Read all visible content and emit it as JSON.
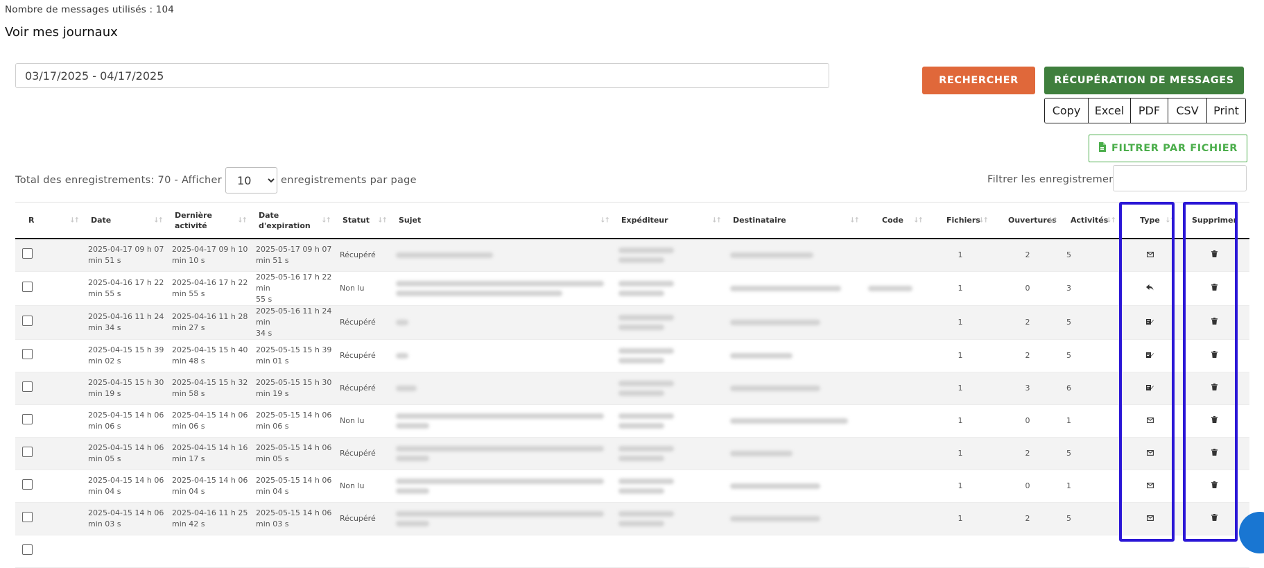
{
  "header": {
    "message_count_text": "Nombre de messages utilisés : 104",
    "title": "Voir mes journaux"
  },
  "search": {
    "date_range_value": "03/17/2025 - 04/17/2025",
    "search_label": "RECHERCHER",
    "recover_label": "RÉCUPÉRATION DE MESSAGES"
  },
  "export": {
    "copy": "Copy",
    "excel": "Excel",
    "pdf": "PDF",
    "csv": "CSV",
    "print": "Print"
  },
  "filter_file_label": "FILTRER PAR FICHIER",
  "pagination": {
    "total_prefix": "Total des enregistrements: 70 - Afficher",
    "page_size": "10",
    "page_size_suffix": "enregistrements par page",
    "filter_label": "Filtrer les enregistrements"
  },
  "columns": {
    "r": "R",
    "date": "Date",
    "last_activity_1": "Dernière",
    "last_activity_2": "activité",
    "expiry_1": "Date",
    "expiry_2": "d'expiration",
    "status": "Statut",
    "subject": "Sujet",
    "sender": "Expéditeur",
    "recipient": "Destinataire",
    "code": "Code",
    "files": "Fichiers",
    "opens": "Ouvertures",
    "activities": "Activités",
    "type": "Type",
    "delete": "Supprimer"
  },
  "rows": [
    {
      "date1": "2025-04-17 09 h 07",
      "date2": "min 51 s",
      "act1": "2025-04-17 09 h 10",
      "act2": "min 10 s",
      "exp1": "2025-05-17 09 h 07",
      "exp2": "min 51 s",
      "status": "Récupéré",
      "files": "1",
      "opens": "2",
      "activities": "5",
      "type_icon": "envelope-icon"
    },
    {
      "date1": "2025-04-16 17 h 22",
      "date2": "min 55 s",
      "act1": "2025-04-16 17 h 22",
      "act2": "min 55 s",
      "exp1": "2025-05-16 17 h 22 min",
      "exp2": "55 s",
      "status": "Non lu",
      "files": "1",
      "opens": "0",
      "activities": "3",
      "type_icon": "reply-icon"
    },
    {
      "date1": "2025-04-16 11 h 24",
      "date2": "min 34 s",
      "act1": "2025-04-16 11 h 28",
      "act2": "min 27 s",
      "exp1": "2025-05-16 11 h 24 min",
      "exp2": "34 s",
      "status": "Récupéré",
      "files": "1",
      "opens": "2",
      "activities": "5",
      "type_icon": "signature-icon"
    },
    {
      "date1": "2025-04-15 15 h 39",
      "date2": "min 02 s",
      "act1": "2025-04-15 15 h 40",
      "act2": "min 48 s",
      "exp1": "2025-05-15 15 h 39",
      "exp2": "min 01 s",
      "status": "Récupéré",
      "files": "1",
      "opens": "2",
      "activities": "5",
      "type_icon": "signature-icon"
    },
    {
      "date1": "2025-04-15 15 h 30",
      "date2": "min 19 s",
      "act1": "2025-04-15 15 h 32",
      "act2": "min 58 s",
      "exp1": "2025-05-15 15 h 30",
      "exp2": "min 19 s",
      "status": "Récupéré",
      "files": "1",
      "opens": "3",
      "activities": "6",
      "type_icon": "signature-icon"
    },
    {
      "date1": "2025-04-15 14 h 06",
      "date2": "min 06 s",
      "act1": "2025-04-15 14 h 06",
      "act2": "min 06 s",
      "exp1": "2025-05-15 14 h 06",
      "exp2": "min 06 s",
      "status": "Non lu",
      "files": "1",
      "opens": "0",
      "activities": "1",
      "type_icon": "envelope-icon"
    },
    {
      "date1": "2025-04-15 14 h 06",
      "date2": "min 05 s",
      "act1": "2025-04-15 14 h 16",
      "act2": "min 17 s",
      "exp1": "2025-05-15 14 h 06",
      "exp2": "min 05 s",
      "status": "Récupéré",
      "files": "1",
      "opens": "2",
      "activities": "5",
      "type_icon": "envelope-icon"
    },
    {
      "date1": "2025-04-15 14 h 06",
      "date2": "min 04 s",
      "act1": "2025-04-15 14 h 06",
      "act2": "min 04 s",
      "exp1": "2025-05-15 14 h 06",
      "exp2": "min 04 s",
      "status": "Non lu",
      "files": "1",
      "opens": "0",
      "activities": "1",
      "type_icon": "envelope-icon"
    },
    {
      "date1": "2025-04-15 14 h 06",
      "date2": "min 03 s",
      "act1": "2025-04-16 11 h 25",
      "act2": "min 42 s",
      "exp1": "2025-05-15 14 h 06",
      "exp2": "min 03 s",
      "status": "Récupéré",
      "files": "1",
      "opens": "2",
      "activities": "5",
      "type_icon": "envelope-icon"
    },
    {
      "date1": "",
      "date2": "",
      "act1": "",
      "act2": "",
      "exp1": "",
      "exp2": "",
      "status": "",
      "files": "",
      "opens": "",
      "activities": "",
      "type_icon": ""
    }
  ],
  "colors": {
    "search_button": "#e0683a",
    "recover_button": "#3f7f3d",
    "filter_file_button": "#4cae4c",
    "highlight_box": "#2a16d6"
  }
}
